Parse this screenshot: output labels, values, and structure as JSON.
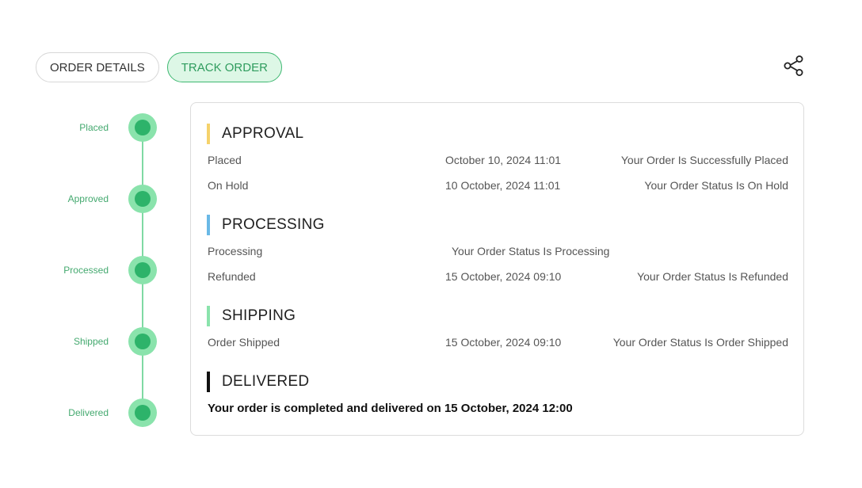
{
  "tabs": [
    {
      "label": "ORDER DETAILS",
      "active": false
    },
    {
      "label": "TRACK ORDER",
      "active": true
    }
  ],
  "share_icon": "share-icon",
  "timeline": {
    "steps": [
      "Placed",
      "Approved",
      "Processed",
      "Shipped",
      "Delivered"
    ],
    "colors": {
      "line": "#7fd9a3",
      "node_outer": "#8ae3ac",
      "node_inner": "#2db36a",
      "label": "#44a96f"
    }
  },
  "sections": {
    "approval": {
      "title": "APPROVAL",
      "accent": "#f5d26b",
      "rows": [
        {
          "status": "Placed",
          "date": "October 10, 2024 11:01",
          "message": "Your Order Is Successfully Placed"
        },
        {
          "status": "On Hold",
          "date": "10 October, 2024 11:01",
          "message": "Your Order Status Is On Hold"
        }
      ]
    },
    "processing": {
      "title": "PROCESSING",
      "accent": "#6ab9e6",
      "rows": [
        {
          "status": "Processing",
          "date": "",
          "message": "Your Order Status Is Processing"
        },
        {
          "status": "Refunded",
          "date": "15 October, 2024 09:10",
          "message": "Your Order Status Is Refunded"
        }
      ]
    },
    "shipping": {
      "title": "SHIPPING",
      "accent": "#8ae3ac",
      "rows": [
        {
          "status": "Order Shipped",
          "date": "15 October, 2024 09:10",
          "message": "Your Order Status Is Order Shipped"
        }
      ]
    },
    "delivered": {
      "title": "DELIVERED",
      "accent": "#111111",
      "message": "Your order is completed and delivered on 15 October, 2024 12:00"
    }
  }
}
